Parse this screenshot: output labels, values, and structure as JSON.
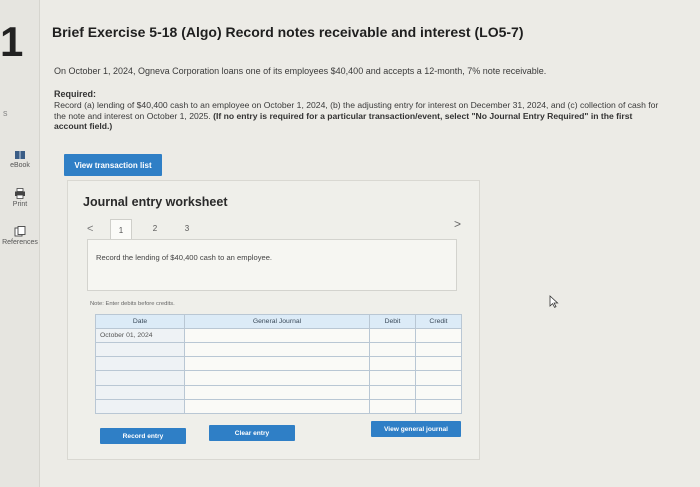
{
  "side": {
    "heading_digit": "1",
    "stray_letter": "s",
    "tools": [
      {
        "label": "eBook",
        "icon": "book-icon"
      },
      {
        "label": "Print",
        "icon": "printer-icon"
      },
      {
        "label": "References",
        "icon": "references-icon"
      }
    ]
  },
  "header": {
    "title": "Brief Exercise 5-18 (Algo) Record notes receivable and interest (LO5-7)"
  },
  "problem": {
    "intro": "On October 1, 2024, Ogneva Corporation loans one of its employees $40,400 and accepts a 12-month, 7% note receivable.",
    "required_label": "Required:",
    "required_text": "Record (a) lending of $40,400 cash to an employee on October 1, 2024, (b) the adjusting entry for interest on December 31, 2024, and (c) collection of cash for the note and interest on October 1, 2025.",
    "required_bold": "(If no entry is required for a particular transaction/event, select \"No Journal Entry Required\" in the first account field.)"
  },
  "buttons": {
    "view_transaction_list": "View transaction list",
    "record_entry": "Record entry",
    "clear_entry": "Clear entry",
    "view_general_journal": "View general journal"
  },
  "worksheet": {
    "title": "Journal entry worksheet",
    "nav_prev": "<",
    "nav_next": ">",
    "tabs": [
      "1",
      "2",
      "3"
    ],
    "active_tab": "1",
    "instruction": "Record the lending of $40,400 cash to an employee.",
    "note": "Note: Enter debits before credits.",
    "table": {
      "headers": [
        "Date",
        "General Journal",
        "Debit",
        "Credit"
      ],
      "rows": [
        [
          "October 01, 2024",
          "",
          "",
          ""
        ],
        [
          "",
          "",
          "",
          ""
        ],
        [
          "",
          "",
          "",
          ""
        ],
        [
          "",
          "",
          "",
          ""
        ],
        [
          "",
          "",
          "",
          ""
        ],
        [
          "",
          "",
          "",
          ""
        ]
      ]
    }
  },
  "colors": {
    "accent_button": "#2f7fc6",
    "table_header": "#dcebf7",
    "background": "#ecebe6"
  }
}
